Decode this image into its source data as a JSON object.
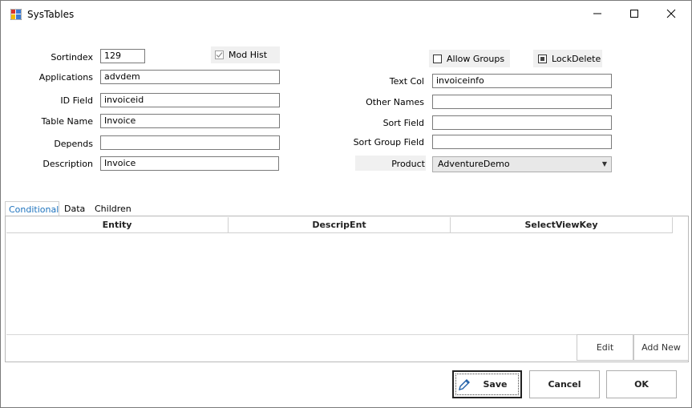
{
  "window": {
    "title": "SysTables",
    "min_icon": "minimize-icon",
    "max_icon": "maximize-icon",
    "close_icon": "close-icon"
  },
  "form": {
    "sortindex": {
      "label": "Sortindex",
      "value": "129"
    },
    "mod_hist": {
      "label": "Mod Hist",
      "checked": true
    },
    "allow_groups": {
      "label": "Allow Groups",
      "checked": false
    },
    "lock_delete": {
      "label": "LockDelete",
      "checked": "indeterminate"
    },
    "applications": {
      "label": "Applications",
      "value": "advdem"
    },
    "text_col": {
      "label": "Text Col",
      "value": "invoiceinfo"
    },
    "id_field": {
      "label": "ID Field",
      "value": "invoiceid"
    },
    "other_names": {
      "label": "Other Names",
      "value": ""
    },
    "table_name": {
      "label": "Table Name",
      "value": "Invoice"
    },
    "sort_field": {
      "label": "Sort Field",
      "value": ""
    },
    "depends": {
      "label": "Depends",
      "value": ""
    },
    "sort_group_field": {
      "label": "Sort Group Field",
      "value": ""
    },
    "description": {
      "label": "Description",
      "value": "Invoice"
    },
    "product": {
      "label": "Product",
      "value": "AdventureDemo"
    }
  },
  "tabs": [
    "Conditional",
    "Data",
    "Children"
  ],
  "grid": {
    "columns": [
      "Entity",
      "DescripEnt",
      "SelectViewKey"
    ]
  },
  "panel_buttons": {
    "edit": "Edit",
    "add_new": "Add New"
  },
  "footer": {
    "save": "Save",
    "cancel": "Cancel",
    "ok": "OK"
  }
}
